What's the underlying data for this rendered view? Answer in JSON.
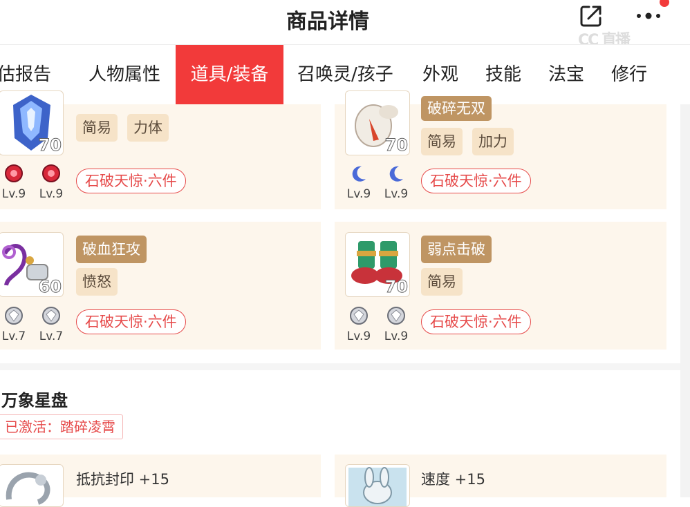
{
  "header": {
    "title": "商品详情",
    "back_icon": "back-arrow-icon",
    "share_icon": "share-icon",
    "more_icon": "more-icon",
    "watermark": "CC 直播"
  },
  "tabs": [
    {
      "label": "评估报告",
      "active": false
    },
    {
      "label": "人物属性",
      "active": false
    },
    {
      "label": "道具/装备",
      "active": true
    },
    {
      "label": "召唤灵/孩子",
      "active": false
    },
    {
      "label": "外观",
      "active": false
    },
    {
      "label": "技能",
      "active": false
    },
    {
      "label": "法宝",
      "active": false
    },
    {
      "label": "修行",
      "active": false
    }
  ],
  "equipment": [
    {
      "level": "70",
      "special": "",
      "tags": [
        "简易",
        "力体"
      ],
      "set": "石破天惊·六件",
      "gems": [
        {
          "type": "red-gem-icon",
          "lv": "Lv.9"
        },
        {
          "type": "red-gem-icon",
          "lv": "Lv.9"
        }
      ]
    },
    {
      "level": "70",
      "special": "破碎无双",
      "tags": [
        "简易",
        "加力"
      ],
      "set": "石破天惊·六件",
      "gems": [
        {
          "type": "moon-gem-icon",
          "lv": "Lv.9"
        },
        {
          "type": "moon-gem-icon",
          "lv": "Lv.9"
        }
      ]
    },
    {
      "level": "60",
      "special": "破血狂攻",
      "tags": [
        "愤怒"
      ],
      "set": "石破天惊·六件",
      "gems": [
        {
          "type": "diamond-gem-icon",
          "lv": "Lv.7"
        },
        {
          "type": "diamond-gem-icon",
          "lv": "Lv.7"
        }
      ]
    },
    {
      "level": "70",
      "special": "弱点击破",
      "tags": [
        "简易"
      ],
      "set": "石破天惊·六件",
      "gems": [
        {
          "type": "diamond-gem-icon",
          "lv": "Lv.9"
        },
        {
          "type": "diamond-gem-icon",
          "lv": "Lv.9"
        }
      ]
    }
  ],
  "star_chart": {
    "title": "万象星盘",
    "activated": "已激活：踏碎凌霄",
    "items": [
      {
        "stat": "抵抗封印 +15"
      },
      {
        "stat": "速度 +15"
      }
    ]
  },
  "colors": {
    "accent": "#f23a3a",
    "card_bg": "#fdf6ec",
    "tag_dark": "#bf9563",
    "tag_light": "#f6e3c8"
  }
}
